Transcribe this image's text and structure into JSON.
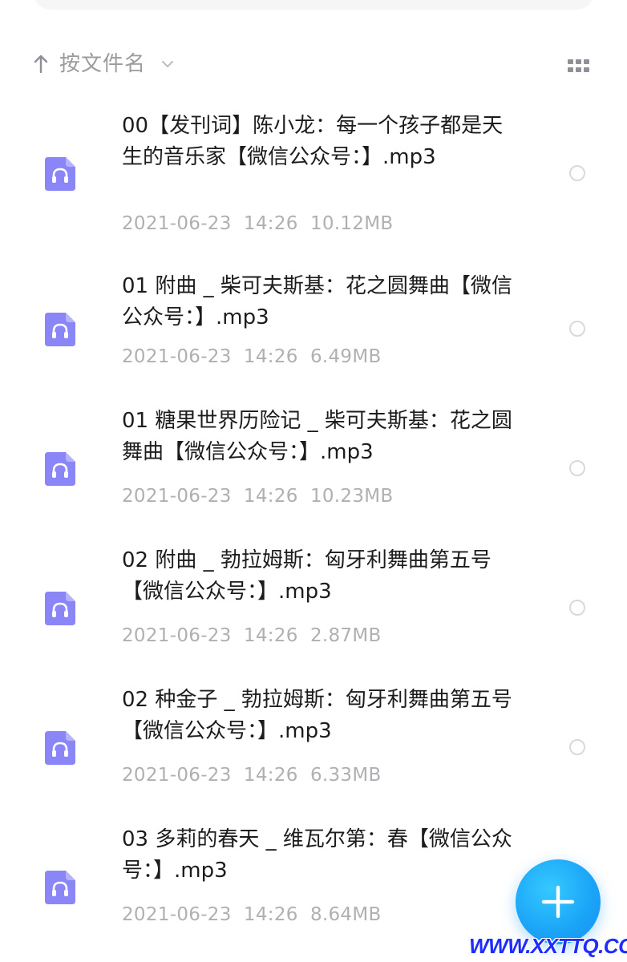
{
  "sort_bar": {
    "label": "按文件名",
    "arrow_icon": "arrow-up-icon",
    "chevron_icon": "chevron-down-icon",
    "view_icon": "grid-view-icon"
  },
  "colors": {
    "accent": "#1aa3f7",
    "file_icon": "#8b86f7",
    "watermark": "#1d2cff"
  },
  "files": [
    {
      "name": "00【发刊词】陈小龙：每一个孩子都是天生的音乐家【微信公众号：】.mp3",
      "date": "2021-06-23",
      "time": "14:26",
      "size": "10.12MB"
    },
    {
      "name": "01 附曲 _ 柴可夫斯基：花之圆舞曲【微信公众号：】.mp3",
      "date": "2021-06-23",
      "time": "14:26",
      "size": "6.49MB"
    },
    {
      "name": "01 糖果世界历险记 _ 柴可夫斯基：花之圆舞曲【微信公众号：】.mp3",
      "date": "2021-06-23",
      "time": "14:26",
      "size": "10.23MB"
    },
    {
      "name": "02 附曲 _ 勃拉姆斯：匈牙利舞曲第五号【微信公众号：】.mp3",
      "date": "2021-06-23",
      "time": "14:26",
      "size": "2.87MB"
    },
    {
      "name": "02 种金子 _ 勃拉姆斯：匈牙利舞曲第五号【微信公众号：】.mp3",
      "date": "2021-06-23",
      "time": "14:26",
      "size": "6.33MB"
    },
    {
      "name": "03 多莉的春天 _ 维瓦尔第：春【微信公众号：】.mp3",
      "date": "2021-06-23",
      "time": "14:26",
      "size": "8.64MB"
    }
  ],
  "fab": {
    "icon": "plus-icon"
  },
  "watermark": {
    "text": "WWW.XXTTQ.COM"
  }
}
